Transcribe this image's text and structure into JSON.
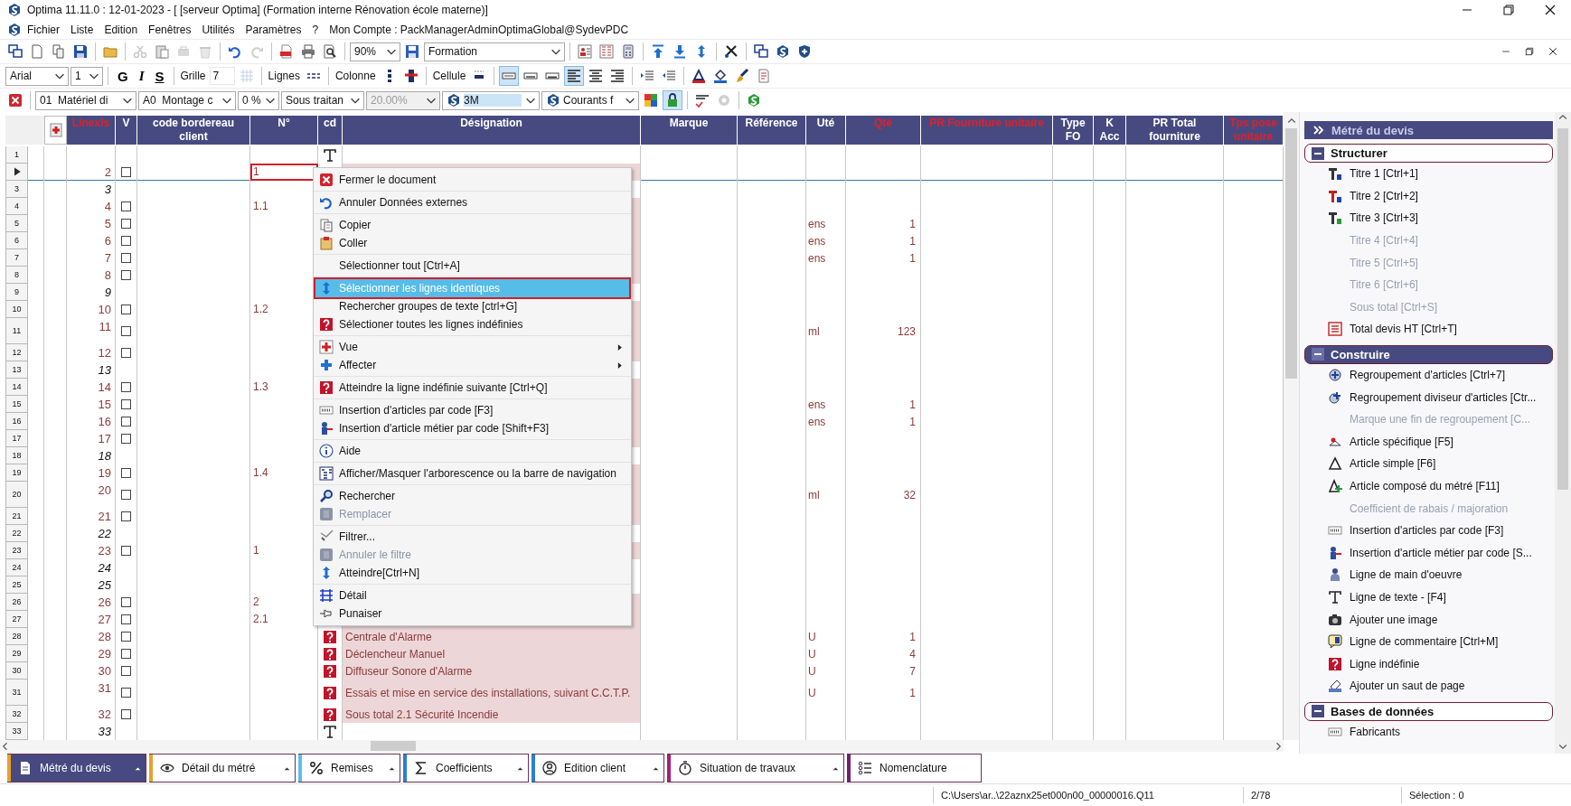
{
  "window": {
    "title": "Optima 11.11.0 : 12-01-2023 - [ [serveur Optima] (Formation interne Rénovation école materne)]"
  },
  "menu_bar": {
    "items": [
      "Fichier",
      "Liste",
      "Edition",
      "Fenêtres",
      "Utilités",
      "Paramètres",
      "?"
    ],
    "account": "Mon Compte : PackManagerAdminOptimaGlobal@SydevPDC"
  },
  "toolbars": [
    {
      "items": [
        {
          "kind": "icon",
          "disabled": false
        },
        {
          "kind": "icon",
          "disabled": false
        },
        {
          "kind": "icon",
          "disabled": false
        },
        {
          "kind": "icon",
          "disabled": false
        },
        {
          "kind": "separator"
        },
        {
          "kind": "icon",
          "disabled": false
        },
        {
          "kind": "separator"
        },
        {
          "kind": "icon",
          "disabled": true
        },
        {
          "kind": "icon",
          "disabled": false
        },
        {
          "kind": "icon",
          "disabled": true
        },
        {
          "kind": "icon",
          "disabled": true
        },
        {
          "kind": "separator"
        },
        {
          "kind": "icon",
          "disabled": false
        },
        {
          "kind": "icon",
          "disabled": true
        },
        {
          "kind": "separator"
        },
        {
          "kind": "icon",
          "disabled": false
        },
        {
          "kind": "icon",
          "disabled": false
        },
        {
          "kind": "icon",
          "disabled": false
        },
        {
          "kind": "separator"
        },
        {
          "kind": "combo",
          "value": "90%",
          "disabled": false,
          "focused": false,
          "logo": false
        },
        {
          "kind": "icon",
          "disabled": false
        },
        {
          "kind": "combo",
          "value": "Formation",
          "disabled": false,
          "focused": false,
          "logo": false
        },
        {
          "kind": "separator"
        },
        {
          "kind": "icon",
          "disabled": false
        },
        {
          "kind": "icon",
          "disabled": false
        },
        {
          "kind": "icon",
          "disabled": false
        },
        {
          "kind": "separator"
        },
        {
          "kind": "icon",
          "disabled": false
        },
        {
          "kind": "icon",
          "disabled": false
        },
        {
          "kind": "icon",
          "disabled": false
        },
        {
          "kind": "separator"
        },
        {
          "kind": "icon",
          "disabled": false
        },
        {
          "kind": "separator"
        },
        {
          "kind": "icon",
          "disabled": false
        },
        {
          "kind": "icon",
          "disabled": false
        },
        {
          "kind": "icon",
          "disabled": false
        }
      ]
    },
    {
      "items": [
        {
          "kind": "combo",
          "value": "Arial",
          "disabled": false,
          "focused": false,
          "logo": false
        },
        {
          "kind": "combo",
          "value": "1",
          "disabled": false,
          "focused": false,
          "logo": false
        },
        {
          "kind": "separator"
        },
        {
          "kind": "text_button",
          "label": "G"
        },
        {
          "kind": "text_button",
          "label": "I"
        },
        {
          "kind": "text_button",
          "label": "S"
        },
        {
          "kind": "separator"
        },
        {
          "kind": "label",
          "text": "Grille"
        },
        {
          "kind": "field",
          "value": "7"
        },
        {
          "kind": "icon",
          "disabled": true
        },
        {
          "kind": "separator"
        },
        {
          "kind": "label",
          "text": "Lignes"
        },
        {
          "kind": "icon",
          "disabled": false
        },
        {
          "kind": "separator"
        },
        {
          "kind": "label",
          "text": "Colonne"
        },
        {
          "kind": "icon",
          "disabled": false
        },
        {
          "kind": "icon",
          "disabled": false
        },
        {
          "kind": "separator"
        },
        {
          "kind": "label",
          "text": "Cellule"
        },
        {
          "kind": "icon",
          "disabled": false
        },
        {
          "kind": "separator"
        },
        {
          "kind": "toggle",
          "selected": true
        },
        {
          "kind": "toggle",
          "selected": false
        },
        {
          "kind": "toggle",
          "selected": false
        },
        {
          "kind": "toggle",
          "selected": true
        },
        {
          "kind": "toggle",
          "selected": false
        },
        {
          "kind": "toggle",
          "selected": false
        },
        {
          "kind": "separator"
        },
        {
          "kind": "icon",
          "disabled": false
        },
        {
          "kind": "icon",
          "disabled": false
        },
        {
          "kind": "separator"
        },
        {
          "kind": "icon",
          "disabled": false
        },
        {
          "kind": "icon",
          "disabled": false
        },
        {
          "kind": "icon",
          "disabled": false
        },
        {
          "kind": "icon",
          "disabled": false
        }
      ]
    },
    {
      "items": [
        {
          "kind": "icon",
          "disabled": false
        },
        {
          "kind": "separator"
        },
        {
          "kind": "combo",
          "value": "01  Matériel di",
          "disabled": false,
          "focused": false,
          "logo": false
        },
        {
          "kind": "combo",
          "value": "A0  Montage c",
          "disabled": false,
          "focused": false,
          "logo": false
        },
        {
          "kind": "combo",
          "value": "0 %",
          "disabled": false,
          "focused": false,
          "logo": false
        },
        {
          "kind": "combo",
          "value": "Sous traitan",
          "disabled": false,
          "focused": false,
          "logo": false
        },
        {
          "kind": "combo",
          "value": "20.00%",
          "disabled": true,
          "focused": false,
          "logo": false
        },
        {
          "kind": "combo",
          "value": "3M",
          "disabled": false,
          "focused": true,
          "logo": true
        },
        {
          "kind": "combo",
          "value": "Courants f",
          "disabled": false,
          "focused": false,
          "logo": true
        },
        {
          "kind": "icon",
          "disabled": false
        },
        {
          "kind": "toggle",
          "selected": true
        },
        {
          "kind": "separator"
        },
        {
          "kind": "icon",
          "disabled": false
        },
        {
          "kind": "icon",
          "disabled": true
        },
        {
          "kind": "separator"
        },
        {
          "kind": "icon",
          "disabled": false
        }
      ]
    }
  ],
  "table": {
    "columns": [
      {
        "label": "Linexls",
        "highlighted": true
      },
      {
        "label": "V",
        "highlighted": false
      },
      {
        "label": "code bordereau client",
        "highlighted": false
      },
      {
        "label": "N°",
        "highlighted": false
      },
      {
        "label": "cd",
        "highlighted": false
      },
      {
        "label": "Désignation",
        "highlighted": false
      },
      {
        "label": "Marque",
        "highlighted": false
      },
      {
        "label": "Référence",
        "highlighted": false
      },
      {
        "label": "Uté",
        "highlighted": false
      },
      {
        "label": "Qté",
        "highlighted": true
      },
      {
        "label": "PR Fourniture unitaire",
        "highlighted": true
      },
      {
        "label": "Type FO",
        "highlighted": false
      },
      {
        "label": "K Acc",
        "highlighted": false
      },
      {
        "label": "PR Total fourniture",
        "highlighted": false
      },
      {
        "label": "Tps pose unitaire",
        "highlighted": true
      }
    ],
    "rows": [
      {
        "number": "1",
        "kind": "text",
        "current": false,
        "tall": false
      },
      {
        "kind": "article",
        "linexls": "2",
        "checked": false,
        "n": "1",
        "current": true,
        "tall": false
      },
      {
        "number": "3",
        "kind": "spacer",
        "linexls": "3",
        "current": false,
        "tall": false
      },
      {
        "number": "4",
        "kind": "article",
        "linexls": "4",
        "checked": false,
        "n": "1.1",
        "current": false,
        "tall": false
      },
      {
        "number": "5",
        "kind": "article",
        "linexls": "5",
        "checked": false,
        "ute": "ens",
        "qte": "1",
        "current": false,
        "tall": false
      },
      {
        "number": "6",
        "kind": "article",
        "linexls": "6",
        "checked": false,
        "ute": "ens",
        "qte": "1",
        "current": false,
        "tall": false
      },
      {
        "number": "7",
        "kind": "article",
        "linexls": "7",
        "checked": false,
        "ute": "ens",
        "qte": "1",
        "current": false,
        "tall": false
      },
      {
        "number": "8",
        "kind": "article",
        "linexls": "8",
        "checked": false,
        "current": false,
        "tall": false
      },
      {
        "number": "9",
        "kind": "spacer",
        "linexls": "9",
        "current": false,
        "tall": false
      },
      {
        "number": "10",
        "kind": "article",
        "linexls": "10",
        "checked": false,
        "n": "1.2",
        "current": false,
        "tall": false
      },
      {
        "number": "11",
        "kind": "article",
        "linexls": "11",
        "checked": false,
        "ute": "ml",
        "qte": "123",
        "current": false,
        "tall": true
      },
      {
        "number": "12",
        "kind": "article",
        "linexls": "12",
        "checked": false,
        "current": false,
        "tall": false
      },
      {
        "number": "13",
        "kind": "spacer",
        "linexls": "13",
        "current": false,
        "tall": false
      },
      {
        "number": "14",
        "kind": "article",
        "linexls": "14",
        "checked": false,
        "n": "1.3",
        "current": false,
        "tall": false
      },
      {
        "number": "15",
        "kind": "article",
        "linexls": "15",
        "checked": false,
        "ute": "ens",
        "qte": "1",
        "current": false,
        "tall": false
      },
      {
        "number": "16",
        "kind": "article",
        "linexls": "16",
        "checked": false,
        "ute": "ens",
        "qte": "1",
        "current": false,
        "tall": false
      },
      {
        "number": "17",
        "kind": "article",
        "linexls": "17",
        "checked": false,
        "current": false,
        "tall": false
      },
      {
        "number": "18",
        "kind": "spacer",
        "linexls": "18",
        "current": false,
        "tall": false
      },
      {
        "number": "19",
        "kind": "article",
        "linexls": "19",
        "checked": false,
        "n": "1.4",
        "current": false,
        "tall": false
      },
      {
        "number": "20",
        "kind": "article",
        "linexls": "20",
        "checked": false,
        "ute": "ml",
        "qte": "32",
        "current": false,
        "tall": true
      },
      {
        "number": "21",
        "kind": "article",
        "linexls": "21",
        "checked": false,
        "current": false,
        "tall": false
      },
      {
        "number": "22",
        "kind": "spacer",
        "linexls": "22",
        "current": false,
        "tall": false
      },
      {
        "number": "23",
        "kind": "article",
        "linexls": "23",
        "checked": false,
        "n": "1",
        "current": false,
        "tall": false
      },
      {
        "number": "24",
        "kind": "spacer",
        "linexls": "24",
        "current": false,
        "tall": false
      },
      {
        "number": "25",
        "kind": "spacer",
        "linexls": "25",
        "current": false,
        "tall": false
      },
      {
        "number": "26",
        "kind": "article",
        "linexls": "26",
        "checked": false,
        "n": "2",
        "current": false,
        "tall": false
      },
      {
        "number": "27",
        "kind": "article",
        "linexls": "27",
        "checked": false,
        "n": "2.1",
        "current": false,
        "tall": false
      },
      {
        "number": "28",
        "kind": "article",
        "linexls": "28",
        "checked": false,
        "undefined": true,
        "designation": "Centrale d'Alarme",
        "ute": "U",
        "qte": "1",
        "current": false,
        "tall": false
      },
      {
        "number": "29",
        "kind": "article",
        "linexls": "29",
        "checked": false,
        "undefined": true,
        "designation": "Déclencheur Manuel",
        "ute": "U",
        "qte": "4",
        "current": false,
        "tall": false
      },
      {
        "number": "30",
        "kind": "article",
        "linexls": "30",
        "checked": false,
        "undefined": true,
        "designation": "Diffuseur Sonore d'Alarme",
        "ute": "U",
        "qte": "7",
        "current": false,
        "tall": false
      },
      {
        "number": "31",
        "kind": "article",
        "linexls": "31",
        "checked": false,
        "undefined": true,
        "designation": "Essais et mise en service des installations, suivant C.C.T.P.",
        "ute": "U",
        "qte": "1",
        "current": false,
        "tall": true
      },
      {
        "number": "32",
        "kind": "article",
        "linexls": "32",
        "checked": false,
        "undefined": true,
        "designation": "Sous total 2.1 Sécurité Incendie",
        "current": false,
        "tall": false
      },
      {
        "number": "33",
        "kind": "text",
        "linexls": "33",
        "current": false,
        "tall": false
      }
    ]
  },
  "context_menu": {
    "groups": [
      {
        "items": [
          {
            "label": "Fermer le document",
            "disabled": false,
            "selected": false,
            "submenu": false
          }
        ]
      },
      {
        "items": [
          {
            "label": "Annuler Données externes",
            "disabled": false,
            "selected": false,
            "submenu": false
          }
        ]
      },
      {
        "items": [
          {
            "label": "Copier",
            "disabled": false,
            "selected": false,
            "submenu": false
          },
          {
            "label": "Coller",
            "disabled": false,
            "selected": false,
            "submenu": false
          }
        ]
      },
      {
        "items": [
          {
            "label": "Sélectionner tout [Ctrl+A]",
            "disabled": false,
            "selected": false,
            "submenu": false
          }
        ]
      },
      {
        "items": [
          {
            "label": "Sélectionner les lignes identiques",
            "disabled": false,
            "selected": true,
            "submenu": false
          },
          {
            "label": "Rechercher groupes de texte [ctrl+G]",
            "disabled": false,
            "selected": false,
            "submenu": false
          },
          {
            "label": "Sélectioner toutes les lignes indéfinies",
            "disabled": false,
            "selected": false,
            "submenu": false
          }
        ]
      },
      {
        "items": [
          {
            "label": "Vue",
            "disabled": false,
            "selected": false,
            "submenu": true
          },
          {
            "label": "Affecter",
            "disabled": false,
            "selected": false,
            "submenu": true
          }
        ]
      },
      {
        "items": [
          {
            "label": "Atteindre la ligne indéfinie suivante [Ctrl+Q]",
            "disabled": false,
            "selected": false,
            "submenu": false
          }
        ]
      },
      {
        "items": [
          {
            "label": "Insertion d'articles par code [F3]",
            "disabled": false,
            "selected": false,
            "submenu": false
          },
          {
            "label": "Insertion d'article métier par code [Shift+F3]",
            "disabled": false,
            "selected": false,
            "submenu": false
          }
        ]
      },
      {
        "items": [
          {
            "label": "Aide",
            "disabled": false,
            "selected": false,
            "submenu": false
          }
        ]
      },
      {
        "items": [
          {
            "label": "Afficher/Masquer l'arborescence ou la barre de navigation",
            "disabled": false,
            "selected": false,
            "submenu": false
          }
        ]
      },
      {
        "items": [
          {
            "label": "Rechercher",
            "disabled": false,
            "selected": false,
            "submenu": false
          },
          {
            "label": "Remplacer",
            "disabled": true,
            "selected": false,
            "submenu": false
          }
        ]
      },
      {
        "items": [
          {
            "label": "Filtrer...",
            "disabled": false,
            "selected": false,
            "submenu": false
          },
          {
            "label": "Annuler le filtre",
            "disabled": true,
            "selected": false,
            "submenu": false
          },
          {
            "label": "Atteindre[Ctrl+N]",
            "disabled": false,
            "selected": false,
            "submenu": false
          }
        ]
      },
      {
        "items": [
          {
            "label": "Détail",
            "disabled": false,
            "selected": false,
            "submenu": false
          },
          {
            "label": "Punaiser",
            "disabled": false,
            "selected": false,
            "submenu": false
          }
        ]
      }
    ]
  },
  "side_panel": {
    "title": "Métré du devis",
    "sections": [
      {
        "title": "Structurer",
        "expanded": true,
        "selected": false,
        "items": [
          {
            "label": "Titre 1 [Ctrl+1]",
            "disabled": false
          },
          {
            "label": "Titre 2 [Ctrl+2]",
            "disabled": false
          },
          {
            "label": "Titre 3 [Ctrl+3]",
            "disabled": false
          },
          {
            "label": "Titre 4 [Ctrl+4]",
            "disabled": true
          },
          {
            "label": "Titre 5 [Ctrl+5]",
            "disabled": true
          },
          {
            "label": "Titre 6 [Ctrl+6]",
            "disabled": true
          },
          {
            "label": "Sous total [Ctrl+S]",
            "disabled": true
          },
          {
            "label": "Total devis HT [Ctrl+T]",
            "disabled": false
          }
        ]
      },
      {
        "title": "Construire",
        "expanded": true,
        "selected": true,
        "items": [
          {
            "label": "Regroupement d'articles  [Ctrl+7]",
            "disabled": false
          },
          {
            "label": "Regroupement diviseur d'articles [Ctr...",
            "disabled": false
          },
          {
            "label": "Marque une fin de regroupement  [C...",
            "disabled": true
          },
          {
            "label": "Article spécifique [F5]",
            "disabled": false
          },
          {
            "label": "Article simple [F6]",
            "disabled": false
          },
          {
            "label": "Article composé du métré [F11]",
            "disabled": false
          },
          {
            "label": "Coefficient de rabais / majoration",
            "disabled": true
          },
          {
            "label": "Insertion d'articles par code [F3]",
            "disabled": false
          },
          {
            "label": "Insertion d'article métier par code [S...",
            "disabled": false
          },
          {
            "label": "Ligne de main d'oeuvre",
            "disabled": false
          },
          {
            "label": "Ligne de texte - [F4]",
            "disabled": false
          },
          {
            "label": "Ajouter une image",
            "disabled": false
          },
          {
            "label": "Ligne de commentaire [Ctrl+M]",
            "disabled": false
          },
          {
            "label": "Ligne indéfinie",
            "disabled": false
          },
          {
            "label": "Ajouter un saut de page",
            "disabled": false
          }
        ]
      },
      {
        "title": "Bases de données",
        "expanded": true,
        "selected": false,
        "items": [
          {
            "label": "Fabricants",
            "disabled": false
          }
        ]
      }
    ]
  },
  "bottom_tabs": [
    {
      "label": "Métré du devis",
      "selected": true,
      "color": "#e8a030",
      "menu": true
    },
    {
      "label": "Détail du métré",
      "selected": false,
      "color": "#e8a030",
      "menu": true
    },
    {
      "label": "Remises",
      "selected": false,
      "color": "#5bc0e8",
      "menu": true
    },
    {
      "label": "Coefficients",
      "selected": false,
      "color": "#2a7fd0",
      "menu": true
    },
    {
      "label": "Edition client",
      "selected": false,
      "color": "#2a7fd0",
      "menu": true
    },
    {
      "label": "Situation de travaux",
      "selected": false,
      "color": "#a02080",
      "menu": true
    },
    {
      "label": "Nomenclature",
      "selected": false,
      "color": "#702070",
      "menu": false
    }
  ],
  "status_bar": {
    "path": "C:\\Users\\ar..\\22aznx25et000n00_00000016.Q11",
    "position": "2/78",
    "selection": "Sélection : 0"
  }
}
